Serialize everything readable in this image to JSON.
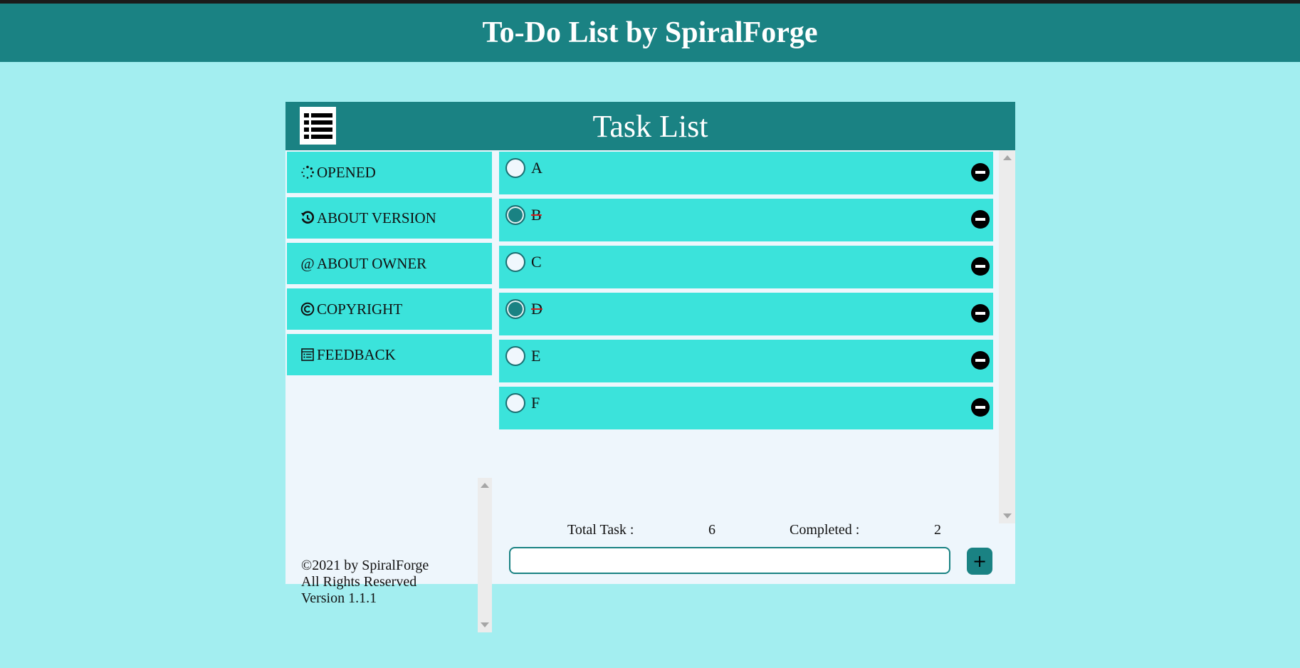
{
  "app": {
    "title": "To-Do List by SpiralForge"
  },
  "panel": {
    "title": "Task List",
    "menu_icon": "list-icon"
  },
  "sidebar": {
    "items": [
      {
        "label": "OPENED",
        "icon": "loading-dots-icon"
      },
      {
        "label": "ABOUT VERSION",
        "icon": "history-icon"
      },
      {
        "label": "ABOUT OWNER",
        "icon": "at-sign-icon"
      },
      {
        "label": "COPYRIGHT",
        "icon": "copyright-icon"
      },
      {
        "label": "FEEDBACK",
        "icon": "feedback-form-icon"
      }
    ],
    "footer": {
      "line1": "©2021 by SpiralForge",
      "line2": "All Rights Reserved",
      "line3": "Version 1.1.1"
    }
  },
  "tasks": [
    {
      "label": "A",
      "completed": false
    },
    {
      "label": "B",
      "completed": true
    },
    {
      "label": "C",
      "completed": false
    },
    {
      "label": "D",
      "completed": true
    },
    {
      "label": "E",
      "completed": false
    },
    {
      "label": "F",
      "completed": false
    }
  ],
  "stats": {
    "total_label": "Total Task :",
    "total_value": "6",
    "completed_label": "Completed :",
    "completed_value": "2"
  },
  "input": {
    "value": "",
    "placeholder": ""
  },
  "add_button": {
    "label": "+"
  },
  "colors": {
    "header": "#1a8283",
    "background": "#a3eef0",
    "item": "#3be3db",
    "panel": "#eef6fc",
    "strike": "#d21f1f"
  }
}
